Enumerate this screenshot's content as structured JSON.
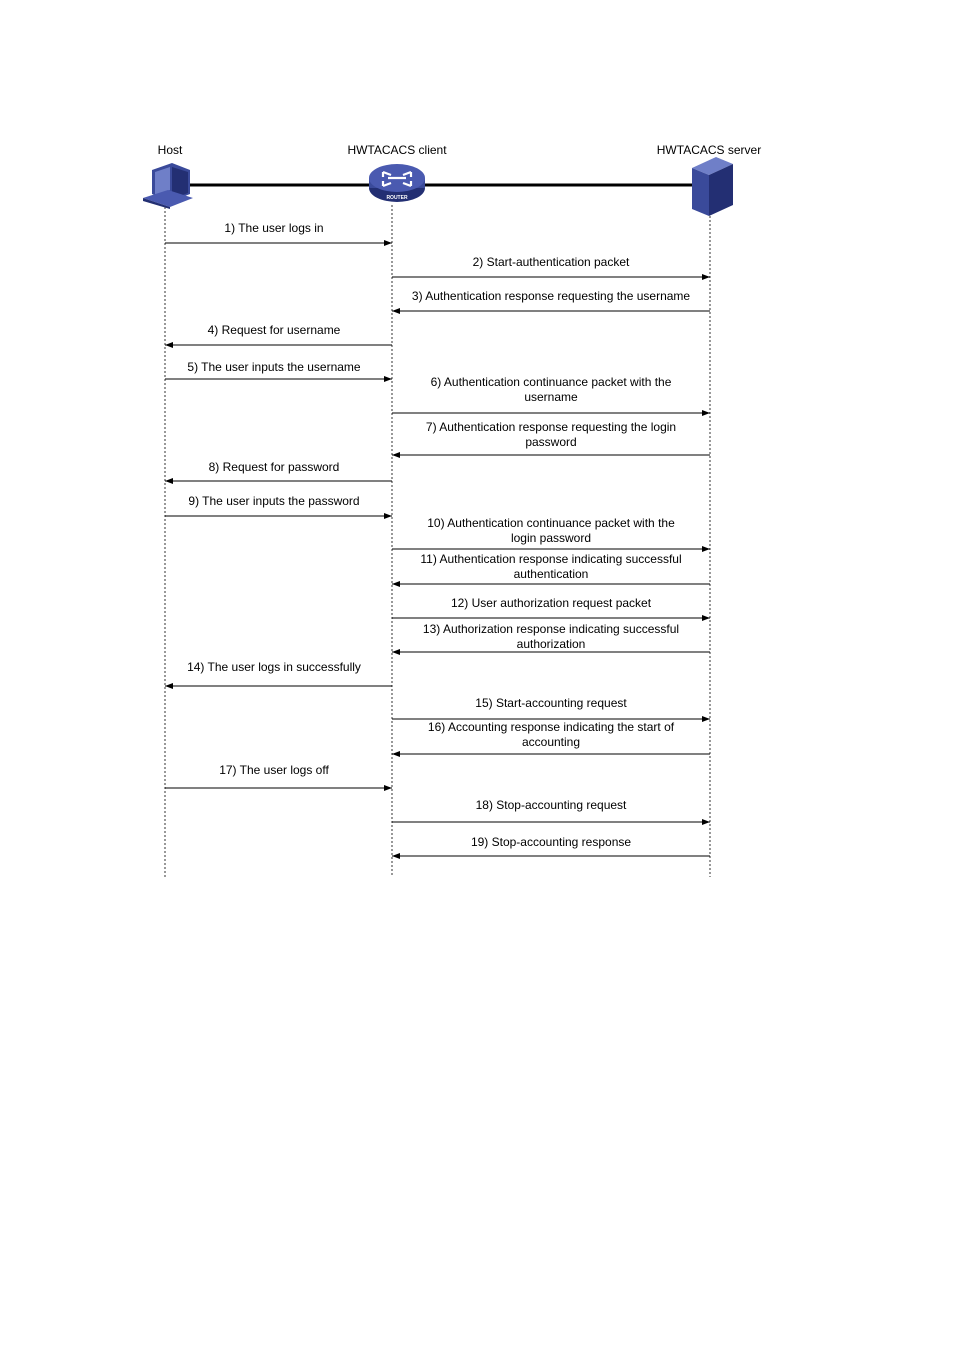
{
  "participants": [
    {
      "id": "host",
      "label": "Host",
      "icon": "computer-icon"
    },
    {
      "id": "client",
      "label": "HWTACACS client",
      "icon": "router-icon",
      "icon_text": "ROUTER"
    },
    {
      "id": "server",
      "label": "HWTACACS server",
      "icon": "server-icon"
    }
  ],
  "colors": {
    "device": "#3a4a9a",
    "device_dark": "#232f73",
    "device_light": "#6f7fc8"
  },
  "messages": [
    {
      "from": "host",
      "to": "client",
      "lines": [
        "1) The user logs in"
      ]
    },
    {
      "from": "client",
      "to": "server",
      "lines": [
        "2) Start-authentication packet"
      ]
    },
    {
      "from": "server",
      "to": "client",
      "lines": [
        "3) Authentication response requesting the username"
      ]
    },
    {
      "from": "client",
      "to": "host",
      "lines": [
        "4) Request for username"
      ]
    },
    {
      "from": "host",
      "to": "client",
      "lines": [
        "5) The user inputs the username"
      ]
    },
    {
      "from": "client",
      "to": "server",
      "lines": [
        "6) Authentication continuance packet with the",
        "username"
      ]
    },
    {
      "from": "server",
      "to": "client",
      "lines": [
        "7) Authentication response requesting the login",
        "password"
      ]
    },
    {
      "from": "client",
      "to": "host",
      "lines": [
        "8) Request for password"
      ]
    },
    {
      "from": "host",
      "to": "client",
      "lines": [
        "9) The user inputs the password"
      ]
    },
    {
      "from": "client",
      "to": "server",
      "lines": [
        "10) Authentication continuance packet with the",
        "login password"
      ]
    },
    {
      "from": "server",
      "to": "client",
      "lines": [
        "11) Authentication response indicating successful",
        "authentication"
      ]
    },
    {
      "from": "client",
      "to": "server",
      "lines": [
        "12) User authorization request packet"
      ]
    },
    {
      "from": "server",
      "to": "client",
      "lines": [
        "13) Authorization response indicating successful",
        "authorization"
      ]
    },
    {
      "from": "client",
      "to": "host",
      "lines": [
        "14) The user logs in successfully"
      ]
    },
    {
      "from": "client",
      "to": "server",
      "lines": [
        "15) Start-accounting request"
      ]
    },
    {
      "from": "server",
      "to": "client",
      "lines": [
        "16) Accounting response indicating the start of",
        "accounting"
      ]
    },
    {
      "from": "host",
      "to": "client",
      "lines": [
        "17) The user logs off"
      ]
    },
    {
      "from": "client",
      "to": "server",
      "lines": [
        "18) Stop-accounting request"
      ]
    },
    {
      "from": "server",
      "to": "client",
      "lines": [
        "19) Stop-accounting response"
      ]
    }
  ]
}
